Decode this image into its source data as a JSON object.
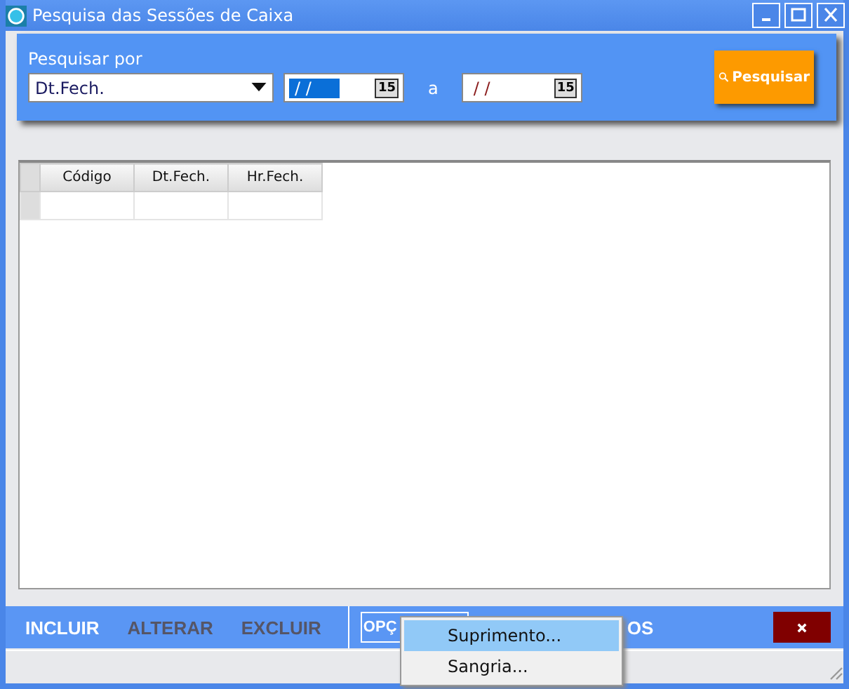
{
  "window": {
    "title": "Pesquisa das Sessões de Caixa"
  },
  "search": {
    "label": "Pesquisar por",
    "field": {
      "value": "Dt.Fech."
    },
    "date_from": {
      "value": "/ /",
      "selected": true,
      "calendar": "15"
    },
    "separator": "a",
    "date_to": {
      "value": "/ /",
      "selected": false,
      "calendar": "15"
    },
    "button": "Pesquisar"
  },
  "table": {
    "columns": [
      "Código",
      "Dt.Fech.",
      "Hr.Fech."
    ]
  },
  "toolbar": [
    {
      "label": "INCLUIR",
      "disabled": false,
      "kind": "plain"
    },
    {
      "label": "ALTERAR",
      "disabled": true,
      "kind": "plain"
    },
    {
      "label": "EXCLUIR",
      "disabled": true,
      "kind": "plain"
    },
    {
      "label": "OPÇ",
      "disabled": false,
      "kind": "outlined"
    },
    {
      "label": "OS",
      "disabled": false,
      "kind": "plain"
    }
  ],
  "menu": [
    {
      "label": "Suprimento...",
      "selected": true
    },
    {
      "label": "Sangria...",
      "selected": false
    }
  ]
}
